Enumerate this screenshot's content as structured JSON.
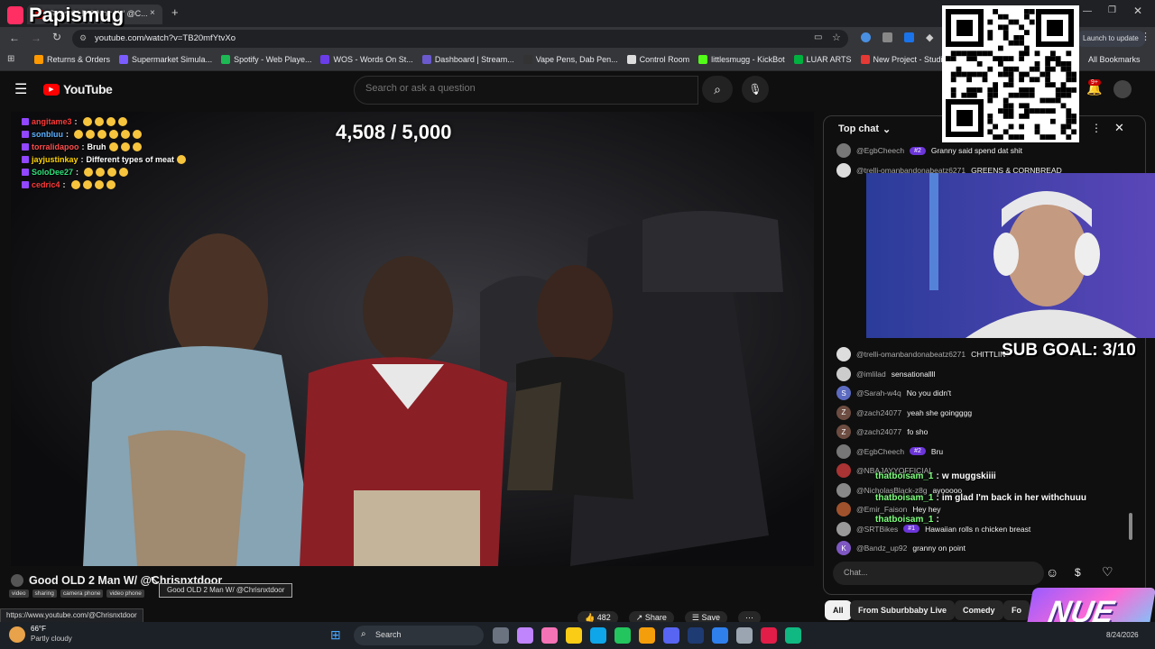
{
  "browser": {
    "tab_title": "Good OLD 2 Man W/ @C...",
    "url": "youtube.com/watch?v=TB20mfYtvXo",
    "update_label": "Launch to update",
    "bookmarks": [
      {
        "label": "Returns & Orders",
        "color": "#ff9900"
      },
      {
        "label": "Supermarket Simula...",
        "color": "#7b5cff"
      },
      {
        "label": "Spotify - Web Playe...",
        "color": "#1db954"
      },
      {
        "label": "WOS - Words On St...",
        "color": "#6a3de8"
      },
      {
        "label": "Dashboard | Stream...",
        "color": "#6a5acd"
      },
      {
        "label": "Vape Pens, Dab Pen...",
        "color": "#333333"
      },
      {
        "label": "Control Room",
        "color": "#dddddd"
      },
      {
        "label": "littlesmugg - KickBot",
        "color": "#53fc18"
      },
      {
        "label": "LUAR ARTS",
        "color": "#00b140"
      },
      {
        "label": "New Project - Studio",
        "color": "#e53935"
      },
      {
        "label": "My",
        "color": "#bbbbbb"
      }
    ],
    "all_bookmarks": "All Bookmarks",
    "status_url": "https://www.youtube.com/@Chrisnxtdoor"
  },
  "stream_overlay": {
    "channel_name": "Papismug",
    "goal_counter": "4,508 / 5,000",
    "sub_goal": "SUB GOAL: 3/10",
    "logo_text": "NUE",
    "twitch_chat": [
      {
        "user": "angitame3",
        "sep": ":",
        "text": "",
        "user_color": "#ff3b3b",
        "emojis": 4
      },
      {
        "user": "sonbluu",
        "sep": ":",
        "text": "",
        "user_color": "#5bb0ff",
        "emojis": 6
      },
      {
        "user": "torralidapoo",
        "sep": ":",
        "text": "Bruh",
        "user_color": "#ff4d4d",
        "emojis": 3
      },
      {
        "user": "jayjustinkay",
        "sep": ":",
        "text": "Different types of meat",
        "user_color": "#ffd400",
        "emojis": 1
      },
      {
        "user": "SoloDee27",
        "sep": ":",
        "text": "",
        "user_color": "#2fe07a",
        "emojis": 4
      },
      {
        "user": "cedric4",
        "sep": ":",
        "text": "",
        "user_color": "#ff3b3b",
        "emojis": 4
      }
    ],
    "overlay_chat": [
      {
        "user": "thatboisam_1",
        "text": "w muggskiiii"
      },
      {
        "user": "thatboisam_1",
        "text": "im glad I'm back in her withchuuu"
      },
      {
        "user": "thatboisam_1",
        "text": ""
      }
    ]
  },
  "youtube": {
    "logo": "YouTube",
    "search_placeholder": "Search or ask a question",
    "notif_count": "9+",
    "video_title": "Good OLD 2 Man W/ @Chrisnxtdoor",
    "tooltip": "Good OLD 2 Man W/ @Chrisnxtdoor",
    "tags": [
      "video",
      "sharing",
      "camera phone",
      "video phone"
    ],
    "like_count": "482",
    "share_label": "Share",
    "save_label": "Save",
    "chat_header": "Top chat",
    "chat_placeholder": "Chat...",
    "chat_messages": [
      {
        "user": "@EgbCheech",
        "badge": "#2",
        "text": "Granny said spend dat shit",
        "av": "#777777",
        "av_letter": ""
      },
      {
        "user": "@trelli-omanbandonabeatz6271",
        "badge": "",
        "text": "GREENS & CORNBREAD",
        "av": "#dddddd",
        "av_letter": ""
      },
      {
        "user": "@trelli-omanbandonabeatz6271",
        "badge": "",
        "text": "CHITTLINS",
        "av": "#dddddd",
        "av_letter": ""
      },
      {
        "user": "@imlilad",
        "badge": "",
        "text": "sensationallll",
        "av": "#cccccc",
        "av_letter": ""
      },
      {
        "user": "@Sarah-w4q",
        "badge": "",
        "text": "No you didn't",
        "av": "#5c6bc0",
        "av_letter": "S"
      },
      {
        "user": "@zach24077",
        "badge": "",
        "text": "yeah she goingggg",
        "av": "#6d4c41",
        "av_letter": "Z"
      },
      {
        "user": "@zach24077",
        "badge": "",
        "text": "fo sho",
        "av": "#6d4c41",
        "av_letter": "Z"
      },
      {
        "user": "@EgbCheech",
        "badge": "#2",
        "text": "Bru",
        "av": "#777777",
        "av_letter": ""
      },
      {
        "user": "@NBAJAYYOFFICIAL",
        "badge": "",
        "text": "",
        "av": "#aa3333",
        "av_letter": ""
      },
      {
        "user": "@NicholasBlack-z8g",
        "badge": "",
        "text": "ayooooo",
        "av": "#888888",
        "av_letter": ""
      },
      {
        "user": "@Emir_Faison",
        "badge": "",
        "text": "Hey hey",
        "av": "#a0522d",
        "av_letter": ""
      },
      {
        "user": "@SRTBikes",
        "badge": "#1",
        "text": "Hawaiian rolls n chicken breast",
        "av": "#999999",
        "av_letter": ""
      },
      {
        "user": "@Bandz_up92",
        "badge": "",
        "text": "granny on point",
        "av": "#7e57c2",
        "av_letter": "K"
      }
    ],
    "chips": [
      "All",
      "From Suburbbaby Live",
      "Comedy",
      "Fo"
    ]
  },
  "taskbar": {
    "temp": "66°F",
    "weather": "Partly cloudy",
    "search_label": "Search",
    "date": "8/24/2026"
  }
}
